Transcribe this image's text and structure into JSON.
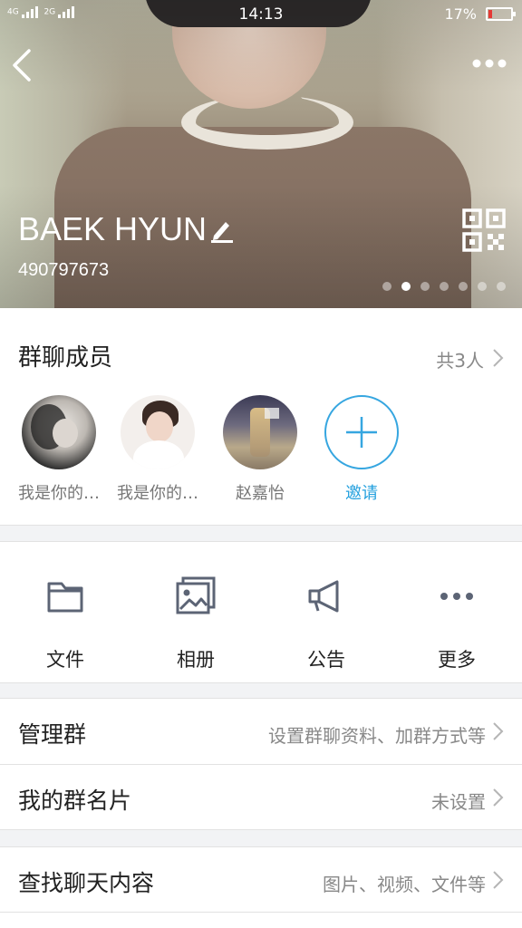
{
  "status_bar": {
    "signal_label_1": "4G",
    "signal_label_2": "2G",
    "time": "14:13",
    "battery_percent": "17%",
    "battery_level": 0.17,
    "battery_color": "#e53935"
  },
  "header": {
    "group_name": "BAEK HYUN",
    "group_id": "490797673",
    "back_icon": "back-arrow-icon",
    "more_icon": "more-dots-icon",
    "edit_icon": "pencil-icon",
    "qr_icon": "qr-code-icon",
    "page_count": 7,
    "active_page": 2
  },
  "members": {
    "title": "群聊成员",
    "count": "共3人",
    "items": [
      {
        "label": "我是你的…"
      },
      {
        "label": "我是你的…"
      },
      {
        "label": "赵嘉怡"
      }
    ],
    "invite_label": "邀请",
    "accent_color": "#23a0de"
  },
  "actions": [
    {
      "label": "文件",
      "icon": "folder-icon"
    },
    {
      "label": "相册",
      "icon": "album-icon"
    },
    {
      "label": "公告",
      "icon": "megaphone-icon"
    },
    {
      "label": "更多",
      "icon": "more-horizontal-icon"
    }
  ],
  "settings": {
    "manage": {
      "title": "管理群",
      "value": "设置群聊资料、加群方式等"
    },
    "card": {
      "title": "我的群名片",
      "value": "未设置"
    },
    "search": {
      "title": "查找聊天内容",
      "value": "图片、视频、文件等"
    }
  }
}
